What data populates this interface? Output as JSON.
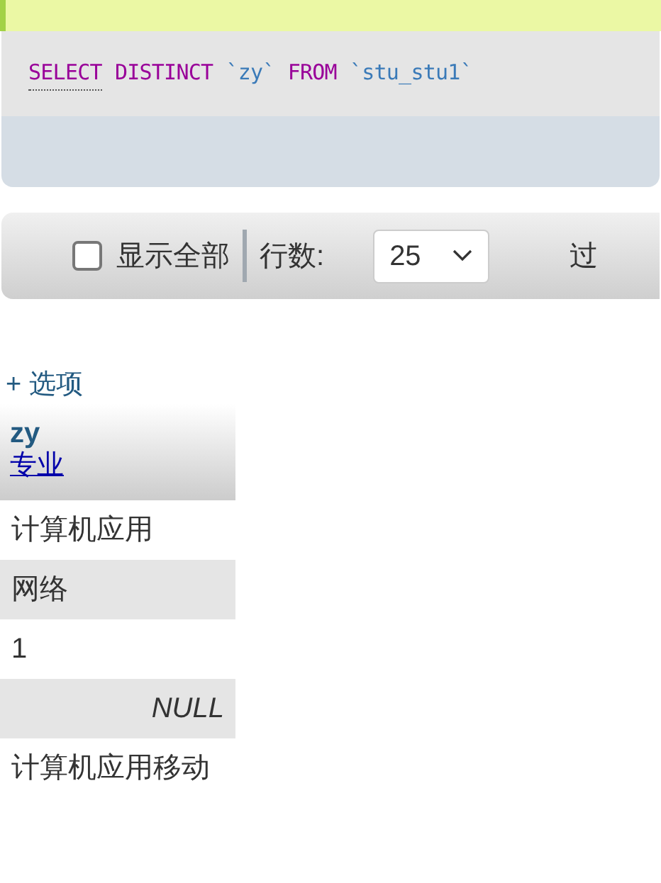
{
  "query": {
    "tokens": [
      {
        "text": "SELECT",
        "kind": "keyword",
        "linked": true
      },
      {
        "text": "DISTINCT",
        "kind": "keyword",
        "linked": false
      },
      {
        "text": "`zy`",
        "kind": "identifier",
        "linked": false
      },
      {
        "text": "FROM",
        "kind": "keyword",
        "linked": false
      },
      {
        "text": "`stu_stu1`",
        "kind": "identifier",
        "linked": false
      }
    ]
  },
  "toolbar": {
    "show_all": {
      "label": "显示全部",
      "checked": false
    },
    "rows_label": "行数:",
    "rows_value": "25",
    "filter_label": "过"
  },
  "options_link": "+ 选项",
  "table": {
    "columns": [
      {
        "name": "zy",
        "comment": "专业"
      }
    ],
    "rows": [
      {
        "value": "计算机应用",
        "kind": "text"
      },
      {
        "value": "网络",
        "kind": "text"
      },
      {
        "value": "1",
        "kind": "text"
      },
      {
        "value": "NULL",
        "kind": "null"
      },
      {
        "value": "计算机应用移动",
        "kind": "text"
      }
    ]
  }
}
